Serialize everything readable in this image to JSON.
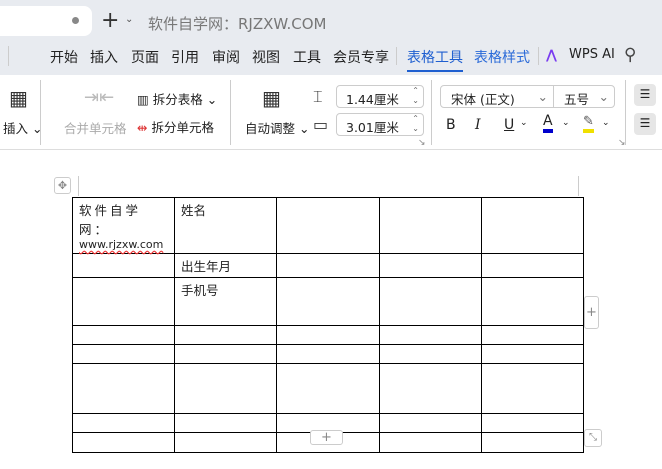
{
  "titlebar": {
    "title": "软件自学网：RJZXW.COM",
    "new_tab": "+",
    "dropdown": "⌄"
  },
  "menu": [
    "开始",
    "插入",
    "页面",
    "引用",
    "审阅",
    "视图",
    "工具",
    "会员专享",
    "表格工具",
    "表格样式",
    "WPS AI"
  ],
  "ribbon": {
    "insert": "插入",
    "merge": "合并单元格",
    "split_table": "拆分表格",
    "split_cell": "拆分单元格",
    "autofit": "自动调整",
    "row_height": "1.44厘米",
    "col_width": "3.01厘米",
    "font": "宋体 (正文)",
    "size": "五号",
    "bold": "B",
    "italic": "I",
    "underline": "U",
    "font_color": "A"
  },
  "colors": {
    "accent": "#1f5fd0",
    "font_color": "#0000cc",
    "highlight": "#f0e000"
  },
  "table": {
    "rows": [
      [
        "软件自学网：",
        "姓名",
        "",
        "",
        ""
      ],
      [
        "",
        "出生年月",
        "",
        "",
        ""
      ],
      [
        "",
        "手机号",
        "",
        "",
        ""
      ],
      [
        "",
        "",
        "",
        "",
        ""
      ],
      [
        "",
        "",
        "",
        "",
        ""
      ],
      [
        "",
        "",
        "",
        "",
        ""
      ],
      [
        "",
        "",
        "",
        "",
        ""
      ],
      [
        "",
        "",
        "",
        "",
        ""
      ]
    ],
    "url": "www.rjzxw.com"
  }
}
